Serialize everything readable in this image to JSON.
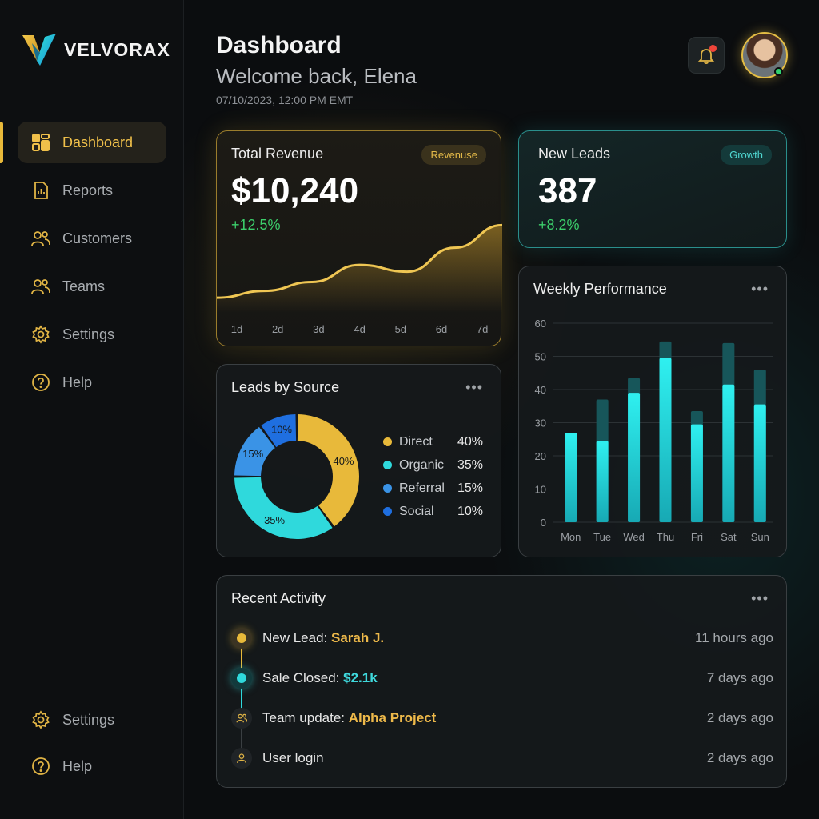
{
  "brand": {
    "name": "VELVORAX"
  },
  "nav": {
    "items": [
      {
        "label": "Dashboard",
        "icon": "dashboard-icon",
        "active": true
      },
      {
        "label": "Reports",
        "icon": "report-icon"
      },
      {
        "label": "Customers",
        "icon": "customers-icon"
      },
      {
        "label": "Teams",
        "icon": "teams-icon"
      },
      {
        "label": "Settings",
        "icon": "gear-icon"
      },
      {
        "label": "Help",
        "icon": "help-icon"
      }
    ],
    "bottom": [
      {
        "label": "Settings",
        "icon": "gear-icon"
      },
      {
        "label": "Help",
        "icon": "help-icon"
      }
    ]
  },
  "header": {
    "title": "Dashboard",
    "welcome": "Welcome back, Elena",
    "timestamp": "07/10/2023, 12:00 PM EMT",
    "notification_icon": "bell-icon",
    "has_unread": true
  },
  "revenue": {
    "title": "Total Revenue",
    "badge": "Revenuse",
    "value": "$10,240",
    "delta": "+12.5%",
    "x_labels": [
      "1d",
      "2d",
      "3d",
      "4d",
      "5d",
      "6d",
      "7d"
    ]
  },
  "new_leads": {
    "title": "New Leads",
    "badge": "Growth",
    "value": "387",
    "delta": "+8.2%"
  },
  "leads_source": {
    "title": "Leads by Source",
    "items": [
      {
        "name": "Direct",
        "value": "40%"
      },
      {
        "name": "Organic",
        "value": "35%"
      },
      {
        "name": "Referral",
        "value": "15%"
      },
      {
        "name": "Social",
        "value": "10%"
      }
    ]
  },
  "weekly": {
    "title": "Weekly Performance"
  },
  "activity": {
    "title": "Recent Activity",
    "items": [
      {
        "prefix": "New Lead: ",
        "highlight": "Sarah J.",
        "time": "11 hours ago",
        "icon": "dot-icon"
      },
      {
        "prefix": "Sale Closed: ",
        "highlight": "$2.1k",
        "time": "7 days ago",
        "icon": "dot-icon"
      },
      {
        "prefix": "Team update: ",
        "highlight": "Alpha Project",
        "time": "2 days ago",
        "icon": "team-icon"
      },
      {
        "prefix": "User login",
        "highlight": "",
        "time": "2 days ago",
        "icon": "user-icon"
      }
    ]
  },
  "colors": {
    "gold": "#e8b93a",
    "teal": "#2fd9dc",
    "blue": "#3a93e6",
    "deep_blue": "#1f6fe0",
    "positive": "#3ccf6b"
  },
  "chart_data": [
    {
      "type": "area",
      "title": "Total Revenue",
      "x": [
        "1d",
        "2d",
        "3d",
        "4d",
        "5d",
        "6d",
        "7d"
      ],
      "series": [
        {
          "values": [
            22,
            32,
            45,
            70,
            60,
            95,
            128
          ]
        }
      ],
      "ylim": [
        0,
        160
      ]
    },
    {
      "type": "pie",
      "title": "Leads by Source",
      "categories": [
        "Direct",
        "Organic",
        "Referral",
        "Social"
      ],
      "values": [
        40,
        35,
        15,
        10
      ],
      "legend": "right"
    },
    {
      "type": "bar",
      "title": "Weekly Performance",
      "categories": [
        "Mon",
        "Tue",
        "Wed",
        "Thu",
        "Fri",
        "Sat",
        "Sun"
      ],
      "series": [
        {
          "values": [
            27,
            24.5,
            39,
            49.5,
            29.5,
            41.5,
            35.5
          ]
        },
        {
          "values": [
            27,
            37,
            43.5,
            54.5,
            33.5,
            54,
            46
          ]
        }
      ],
      "ylim": [
        0,
        60
      ],
      "yticks": [
        0,
        10,
        20,
        30,
        40,
        50,
        60
      ],
      "grid": true
    }
  ]
}
